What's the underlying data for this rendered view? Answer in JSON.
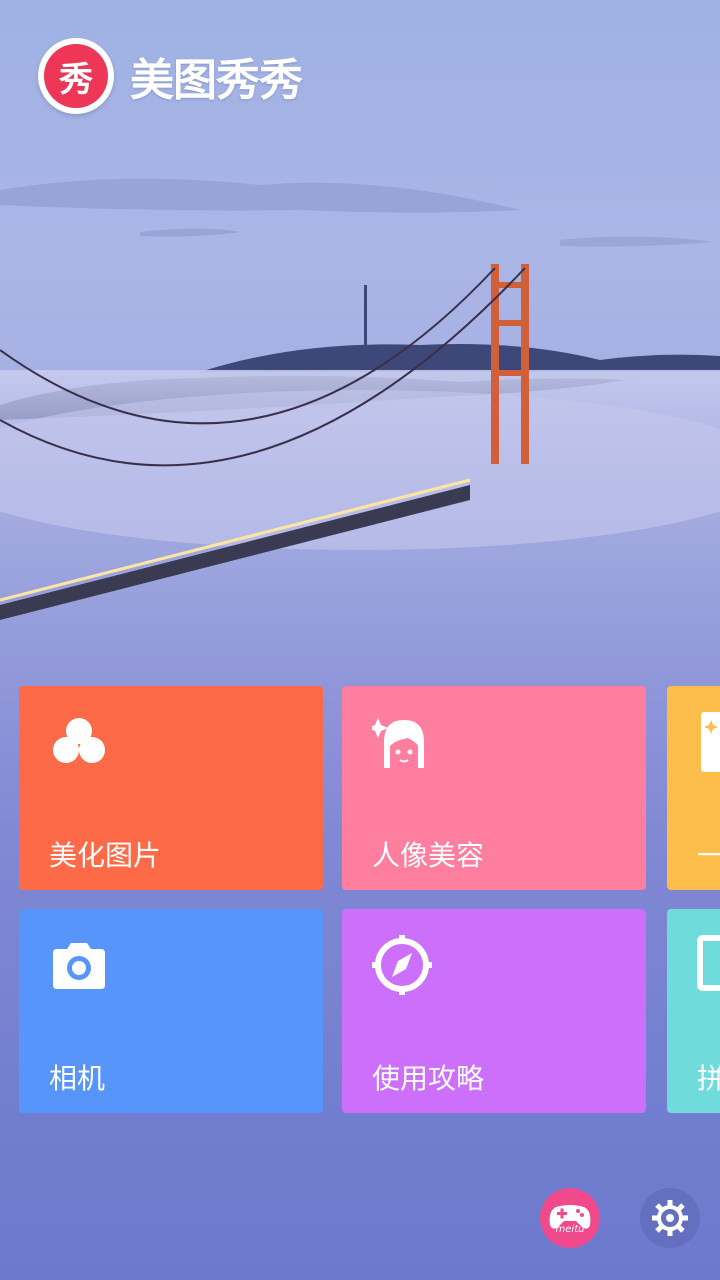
{
  "app": {
    "logo_char": "秀",
    "logo_text": "美图秀秀"
  },
  "tiles": [
    {
      "label": "美化图片",
      "icon": "flower-icon",
      "color": "#fd6a48"
    },
    {
      "label": "人像美容",
      "icon": "face-icon",
      "color": "#fe7ea0"
    },
    {
      "label": "一",
      "icon": "magic-wand-icon",
      "color": "#fdbd4a"
    },
    {
      "label": "相机",
      "icon": "camera-icon",
      "color": "#5795fb"
    },
    {
      "label": "使用攻略",
      "icon": "compass-icon",
      "color": "#cc6ffa"
    },
    {
      "label": "拼",
      "icon": "collage-icon",
      "color": "#6fdcdb"
    }
  ],
  "bottom": {
    "game_label": "meitu",
    "game_icon": "gamepad-icon",
    "settings_icon": "gear-icon",
    "game_color": "#f04a8c"
  }
}
